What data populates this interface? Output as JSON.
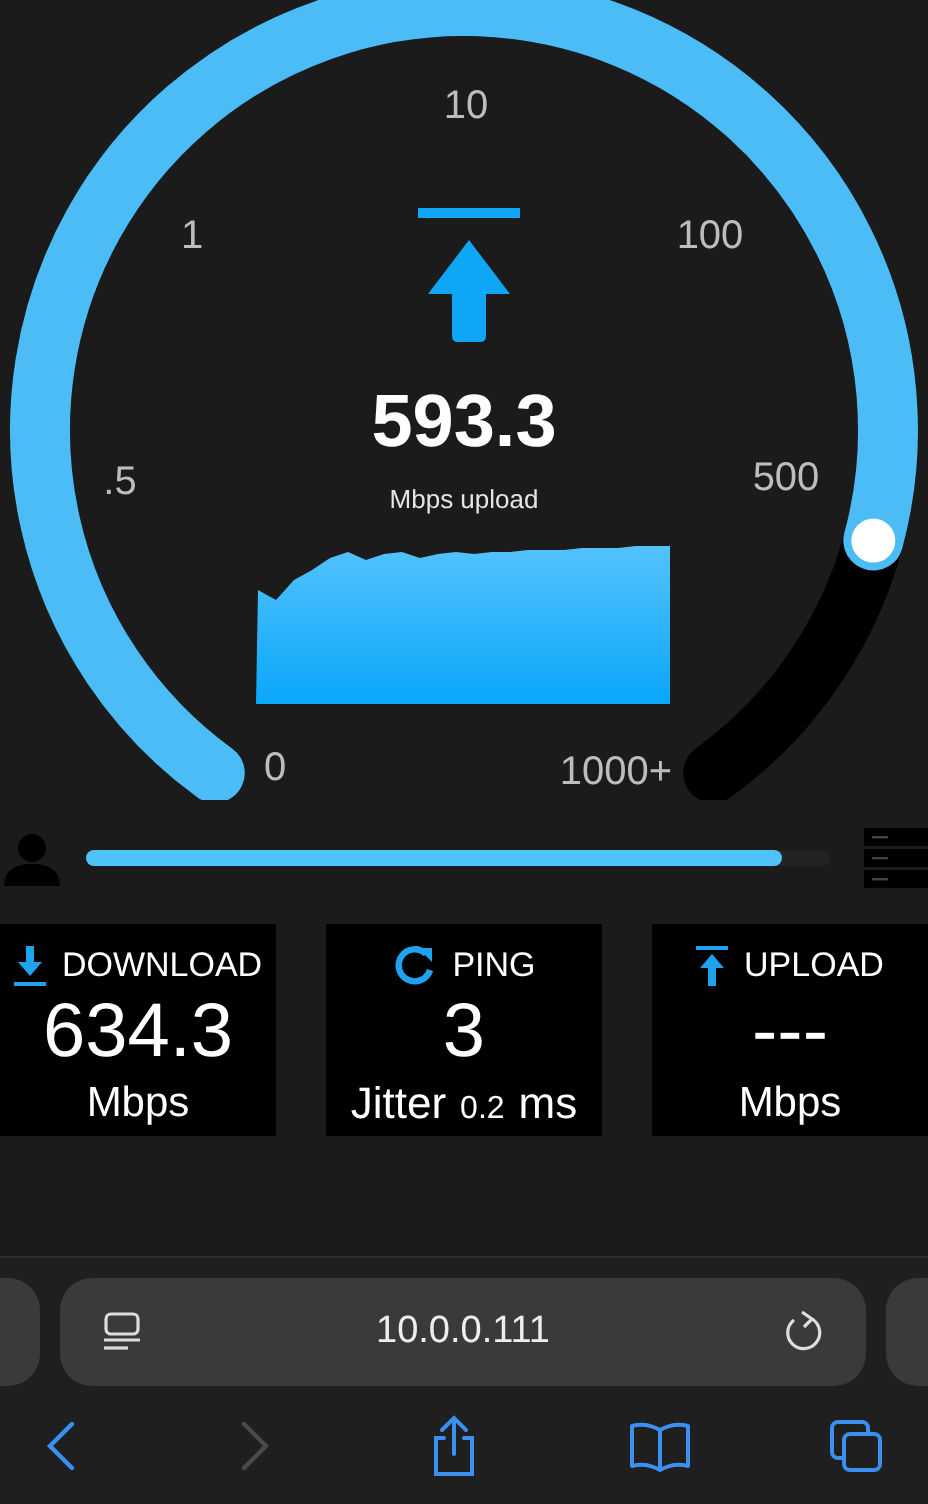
{
  "gauge": {
    "scale_labels": [
      "0",
      ".5",
      "1",
      "10",
      "100",
      "500",
      "1000+"
    ],
    "value": "593.3",
    "unit": "Mbps upload"
  },
  "progress": {
    "level": 0.935
  },
  "results": [
    {
      "kind": "download",
      "label": "DOWNLOAD",
      "value": "634.3",
      "unit": "Mbps"
    },
    {
      "kind": "ping",
      "label": "PING",
      "value": "3",
      "jitter_label": "Jitter",
      "jitter_value": "0.2",
      "jitter_unit": "ms"
    },
    {
      "kind": "upload",
      "label": "UPLOAD",
      "value": "---",
      "unit": "Mbps"
    }
  ],
  "browser": {
    "url": "10.0.0.111",
    "back_disabled": false,
    "forward_disabled": true
  }
}
